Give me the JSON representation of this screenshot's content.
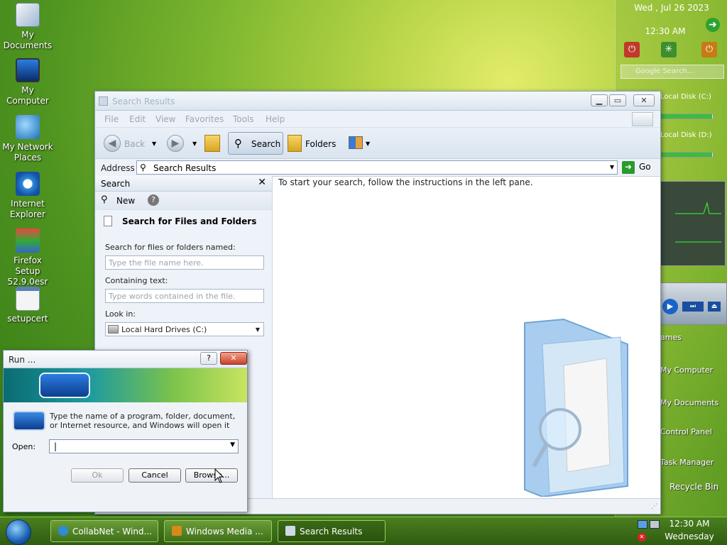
{
  "desktop": {
    "icons": [
      {
        "label_line1": "My",
        "label_line2": "Documents",
        "icon": "my-documents-icon"
      },
      {
        "label_line1": "My Computer",
        "label_line2": "",
        "icon": "my-computer-icon"
      },
      {
        "label_line1": "My Network",
        "label_line2": "Places",
        "icon": "network-places-icon"
      },
      {
        "label_line1": "Internet",
        "label_line2": "Explorer",
        "icon": "internet-explorer-icon"
      },
      {
        "label_line1": "Firefox Setup",
        "label_line2": "52.9.0esr",
        "icon": "firefox-setup-icon"
      },
      {
        "label_line1": "setupcert",
        "label_line2": "",
        "icon": "setupcert-icon"
      }
    ]
  },
  "sidebar": {
    "date": "Wed , Jul 26 2023",
    "time": "12:30 AM",
    "search_placeholder": "Google Search...",
    "disk_c": "Local Disk (C:)",
    "disk_d": "Local Disk (D:)",
    "disk_c_usage": 0.98,
    "disk_d_usage": 0.98,
    "links": [
      "ames",
      "My Computer",
      "My Documents",
      "Control Panel",
      "Task Manager"
    ],
    "recycle": "Recycle Bin"
  },
  "explorer": {
    "title": "Search Results",
    "menu": [
      "File",
      "Edit",
      "View",
      "Favorites",
      "Tools",
      "Help"
    ],
    "toolbar": {
      "back": "Back",
      "search": "Search",
      "folders": "Folders"
    },
    "address_label": "Address",
    "address_value": "Search Results",
    "go": "Go",
    "pane": {
      "title": "Search",
      "new": "New",
      "section": "Search for Files and Folders",
      "named_label": "Search for files or folders named:",
      "named_placeholder": "Type the file name here.",
      "containing_label": "Containing text:",
      "containing_placeholder": "Type words contained in the file.",
      "lookin_label": "Look in:",
      "lookin_value": "Local Hard Drives (C:)"
    },
    "instructions": "To start your search, follow the instructions in the left pane."
  },
  "run": {
    "title": "Run ...",
    "help": "?",
    "description": "Type the name of a program, folder, document, or Internet resource, and Windows will open it",
    "open_label": "Open:",
    "open_value": "",
    "ok": "Ok",
    "cancel": "Cancel",
    "browse": "Browse..."
  },
  "taskbar": {
    "tasks": [
      "CollabNet - Wind...",
      "Windows Media ...",
      "Search Results"
    ],
    "time": "12:30 AM",
    "day": "Wednesday"
  }
}
